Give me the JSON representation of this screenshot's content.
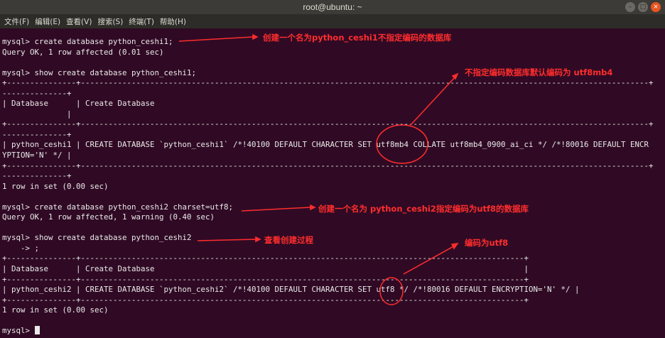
{
  "window": {
    "title": "root@ubuntu: ~"
  },
  "menu": [
    "文件(F)",
    "编辑(E)",
    "查看(V)",
    "搜索(S)",
    "终端(T)",
    "帮助(H)"
  ],
  "terminal": {
    "lines": [
      "mysql> create database python_ceshi1;",
      "Query OK, 1 row affected (0.01 sec)",
      "",
      "mysql> show create database python_ceshi1;",
      "+---------------+---------------------------------------------------------------------------------------------------------------------------+",
      "--------------+",
      "| Database      | Create Database",
      "              |",
      "+---------------+---------------------------------------------------------------------------------------------------------------------------+",
      "--------------+",
      "| python_ceshi1 | CREATE DATABASE `python_ceshi1` /*!40100 DEFAULT CHARACTER SET utf8mb4 COLLATE utf8mb4_0900_ai_ci */ /*!80016 DEFAULT ENCR",
      "YPTION='N' */ |",
      "+---------------+---------------------------------------------------------------------------------------------------------------------------+",
      "--------------+",
      "1 row in set (0.00 sec)",
      "",
      "mysql> create database python_ceshi2 charset=utf8;",
      "Query OK, 1 row affected, 1 warning (0.40 sec)",
      "",
      "mysql> show create database python_ceshi2",
      "    -> ;",
      "+---------------+------------------------------------------------------------------------------------------------+",
      "| Database      | Create Database                                                                                |",
      "+---------------+------------------------------------------------------------------------------------------------+",
      "| python_ceshi2 | CREATE DATABASE `python_ceshi2` /*!40100 DEFAULT CHARACTER SET utf8 */ /*!80016 DEFAULT ENCRYPTION='N' */ |",
      "+---------------+------------------------------------------------------------------------------------------------+",
      "1 row in set (0.00 sec)",
      "",
      "mysql> "
    ]
  },
  "annotations": {
    "a1": "创建一个名为python_ceshi1不指定编码的数据库",
    "a2": "不指定编码数据库默认编码为 utf8mb4",
    "a3": "创建一个名为 python_ceshi2指定编码为utf8的数据库",
    "a4": "查看创建过程",
    "a5": "编码为utf8"
  },
  "colors": {
    "terminal_bg": "#300a24",
    "terminal_fg": "#e9e9e9",
    "annotation": "#ff2d2d"
  }
}
